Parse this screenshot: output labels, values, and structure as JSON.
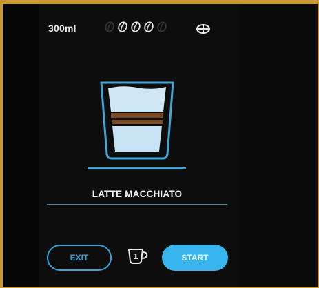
{
  "header": {
    "volume": "300ml",
    "strength": {
      "level": 3,
      "max": 5,
      "icon": "coffee-bean-icon"
    },
    "temperature_icon": "temperature-icon"
  },
  "drink": {
    "name": "LATTE MACCHIATO",
    "icon": "layered-glass-icon",
    "layers": [
      "milk-foam",
      "espresso",
      "milk"
    ]
  },
  "footer": {
    "exit_label": "EXIT",
    "cups_count": "1",
    "cups_icon": "cup-icon",
    "start_label": "START"
  },
  "colors": {
    "accent": "#37b6ee",
    "background": "#050505",
    "frame": "#c99a34",
    "milk": "#c9e3f2",
    "espresso": "#7a4a22"
  }
}
